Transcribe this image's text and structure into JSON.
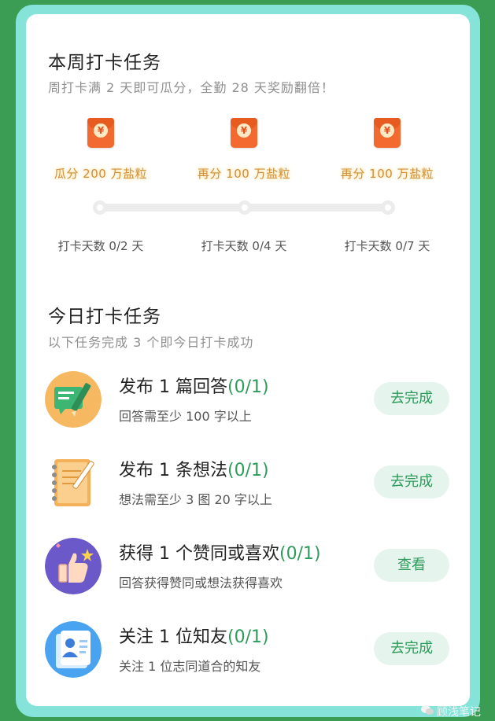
{
  "weekly": {
    "title": "本周打卡任务",
    "subtitle": "周打卡满 2 天即可瓜分，全勤 28 天奖励翻倍！",
    "rewards": [
      {
        "label": "瓜分 200 万盐粒",
        "days": "打卡天数 0/2 天"
      },
      {
        "label": "再分 100 万盐粒",
        "days": "打卡天数 0/4 天"
      },
      {
        "label": "再分 100 万盐粒",
        "days": "打卡天数 0/7 天"
      }
    ],
    "envelope_symbol": "¥"
  },
  "daily": {
    "title": "今日打卡任务",
    "subtitle": "以下任务完成 3 个即今日打卡成功",
    "tasks": [
      {
        "title": "发布 1 篇回答",
        "progress": "(0/1)",
        "desc": "回答需至少 100 字以上",
        "button": "去完成",
        "icon": "answer-pencil-icon"
      },
      {
        "title": "发布 1 条想法",
        "progress": "(0/1)",
        "desc": "想法需至少 3 图 20 字以上",
        "button": "去完成",
        "icon": "notebook-pen-icon"
      },
      {
        "title": "获得 1 个赞同或喜欢",
        "progress": "(0/1)",
        "desc": "回答获得赞同或想法获得喜欢",
        "button": "查看",
        "icon": "thumbs-up-icon"
      },
      {
        "title": "关注 1 位知友",
        "progress": "(0/1)",
        "desc": "关注 1 位志同道合的知友",
        "button": "去完成",
        "icon": "profile-card-icon"
      }
    ]
  },
  "watermark": "顾浅笔记",
  "colors": {
    "background": "#3a9d53",
    "frame": "#86e3d9",
    "accent": "#2d9b5a",
    "envelope": "#f26a2f",
    "reward_text": "#d08e3a"
  }
}
